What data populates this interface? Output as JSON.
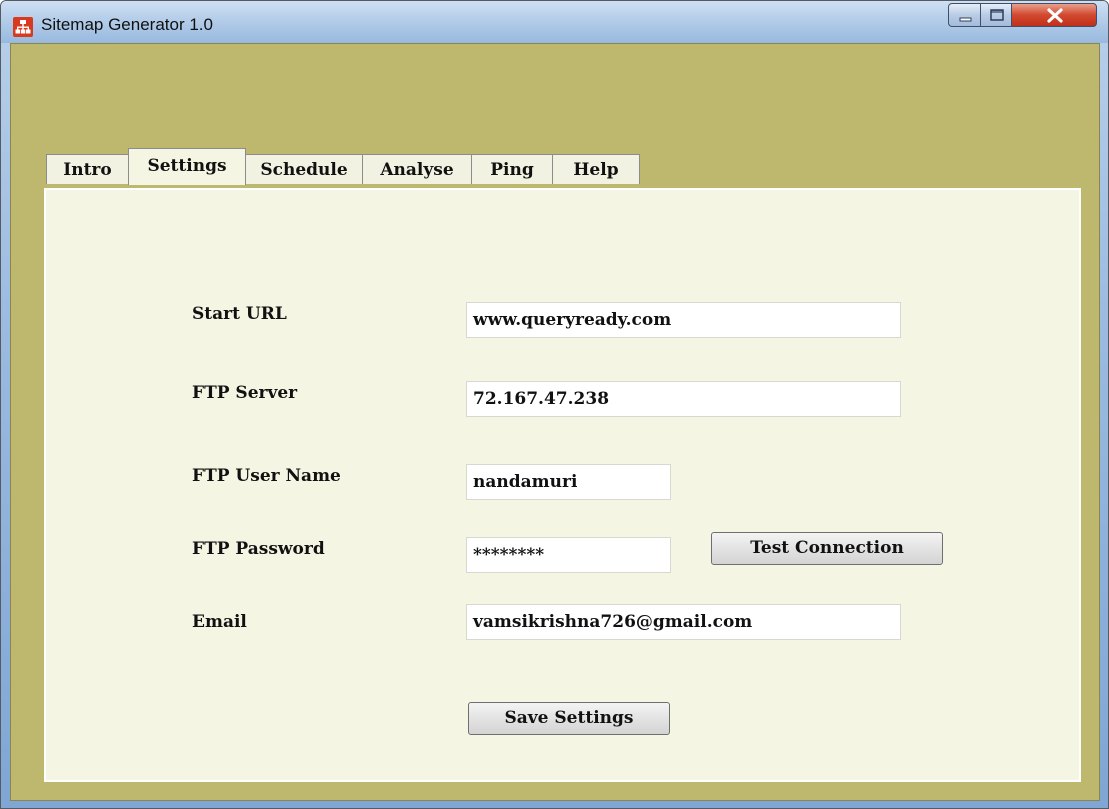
{
  "window": {
    "title": "Sitemap Generator 1.0",
    "icon": "sitemap-icon",
    "controls": [
      "minimize-icon",
      "maximize-icon",
      "close-icon"
    ],
    "colors": {
      "client_background": "#bdb86e",
      "panel_background": "#f5f5e4"
    }
  },
  "tabs": [
    {
      "label": "Intro"
    },
    {
      "label": "Settings",
      "active": true
    },
    {
      "label": "Schedule"
    },
    {
      "label": "Analyse"
    },
    {
      "label": "Ping"
    },
    {
      "label": "Help"
    }
  ],
  "settings": {
    "start_url": {
      "label": "Start URL",
      "value": "www.queryready.com"
    },
    "ftp_server": {
      "label": "FTP Server",
      "value": "72.167.47.238"
    },
    "ftp_user": {
      "label": "FTP User Name",
      "value": "nandamuri"
    },
    "ftp_password": {
      "label": "FTP Password",
      "value": "********"
    },
    "email": {
      "label": "Email",
      "value": "vamsikrishna726@gmail.com"
    },
    "test_connection_label": "Test Connection",
    "save_label": "Save Settings"
  }
}
